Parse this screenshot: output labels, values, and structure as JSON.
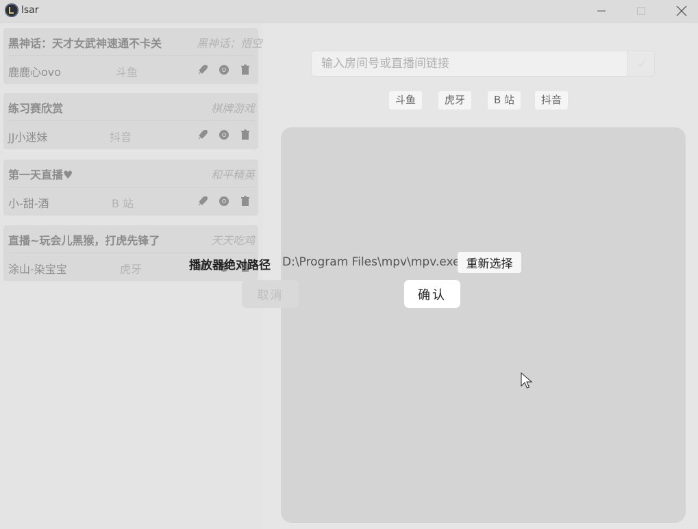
{
  "window": {
    "title": "lsar",
    "controls": {
      "minimize": "minimize-icon",
      "maximize": "maximize-icon",
      "close": "close-icon"
    }
  },
  "sidebar": {
    "cards": [
      {
        "title": "黑神话：天才女武神速通不卡关",
        "category": "黑神话：悟空",
        "streamer": "鹿鹿心ovo",
        "platform": "斗鱼"
      },
      {
        "title": "练习赛欣赏",
        "category": "棋牌游戏",
        "streamer": "JJ小迷妹",
        "platform": "抖音"
      },
      {
        "title": "第一天直播♥",
        "category": "和平精英",
        "streamer": "小-甜-酒",
        "platform": "B 站"
      },
      {
        "title": "直播~玩会儿黑猴，打虎先锋了",
        "category": "天天吃鸡",
        "streamer": "涂山-染宝宝",
        "platform": "虎牙"
      }
    ],
    "card_action_icons": [
      "rocket-icon",
      "chrome-icon",
      "trash-icon"
    ]
  },
  "search": {
    "placeholder": "输入房间号或直播间链接",
    "value": "",
    "submit_icon": "check-icon"
  },
  "platforms": [
    "斗鱼",
    "虎牙",
    "B 站",
    "抖音"
  ],
  "dialog": {
    "label": "播放器绝对路径",
    "path": "D:\\Program Files\\mpv\\mpv.exe",
    "reselect": "重新选择",
    "cancel": "取消",
    "confirm": "确认"
  },
  "colors": {
    "background": "#e6e6e6",
    "panel": "#d4d4d4",
    "card": "#d9d9d9"
  }
}
